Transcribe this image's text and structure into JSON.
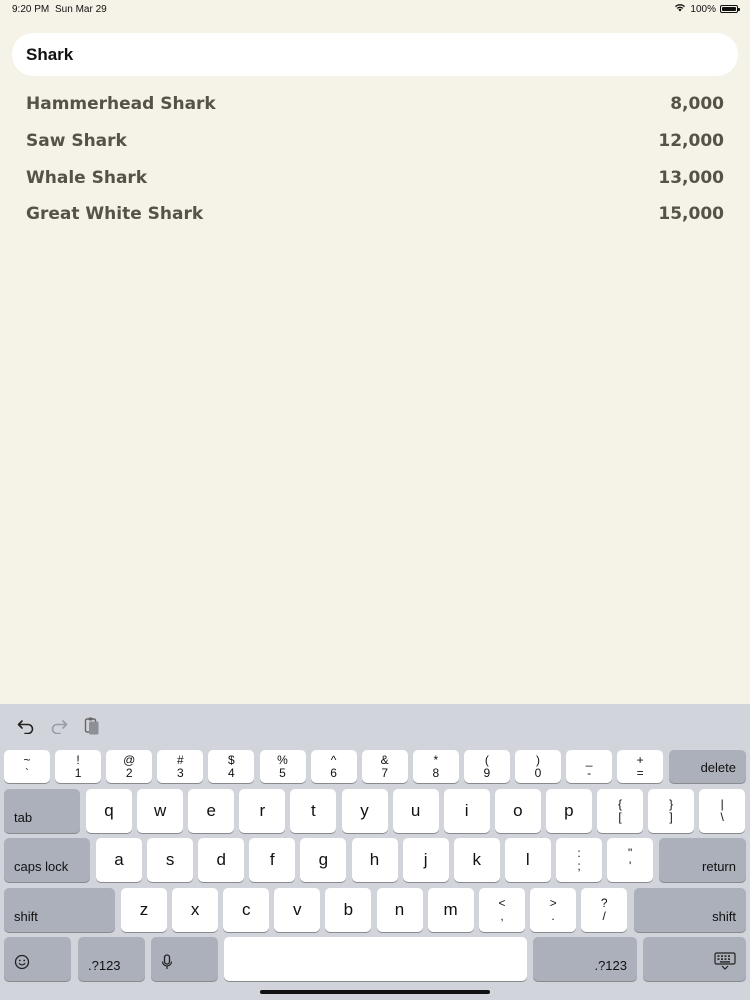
{
  "status": {
    "time": "9:20 PM",
    "date": "Sun Mar 29",
    "battery": "100%"
  },
  "search": {
    "value": "Shark"
  },
  "results": [
    {
      "name": "Hammerhead Shark",
      "value": "8,000"
    },
    {
      "name": "Saw Shark",
      "value": "12,000"
    },
    {
      "name": "Whale Shark",
      "value": "13,000"
    },
    {
      "name": "Great White Shark",
      "value": "15,000"
    }
  ],
  "keyboard": {
    "toolbar": [
      "undo-icon",
      "redo-icon",
      "paste-icon"
    ],
    "number_row": [
      {
        "top": "~",
        "bottom": "`"
      },
      {
        "top": "!",
        "bottom": "1"
      },
      {
        "top": "@",
        "bottom": "2"
      },
      {
        "top": "#",
        "bottom": "3"
      },
      {
        "top": "$",
        "bottom": "4"
      },
      {
        "top": "%",
        "bottom": "5"
      },
      {
        "top": "^",
        "bottom": "6"
      },
      {
        "top": "&",
        "bottom": "7"
      },
      {
        "top": "*",
        "bottom": "8"
      },
      {
        "top": "(",
        "bottom": "9"
      },
      {
        "top": ")",
        "bottom": "0"
      },
      {
        "top": "_",
        "bottom": "-"
      },
      {
        "top": "+",
        "bottom": "="
      }
    ],
    "delete": "delete",
    "tab": "tab",
    "row_q": [
      "q",
      "w",
      "e",
      "r",
      "t",
      "y",
      "u",
      "i",
      "o",
      "p"
    ],
    "row_q_extra": [
      {
        "top": "{",
        "bottom": "["
      },
      {
        "top": "}",
        "bottom": "]"
      },
      {
        "top": "|",
        "bottom": "\\"
      }
    ],
    "caps_lock": "caps lock",
    "row_a": [
      "a",
      "s",
      "d",
      "f",
      "g",
      "h",
      "j",
      "k",
      "l"
    ],
    "row_a_extra": [
      {
        "top": ":",
        "bottom": ";"
      },
      {
        "top": "\"",
        "bottom": "'"
      }
    ],
    "return": "return",
    "shift": "shift",
    "row_z": [
      "z",
      "x",
      "c",
      "v",
      "b",
      "n",
      "m"
    ],
    "row_z_extra": [
      {
        "top": "<",
        "bottom": ","
      },
      {
        "top": ">",
        "bottom": "."
      },
      {
        "top": "?",
        "bottom": "/"
      }
    ],
    "numbers_toggle": ".?123",
    "emoji": "emoji-icon",
    "mic": "microphone-icon",
    "hide": "keyboard-hide-icon"
  }
}
